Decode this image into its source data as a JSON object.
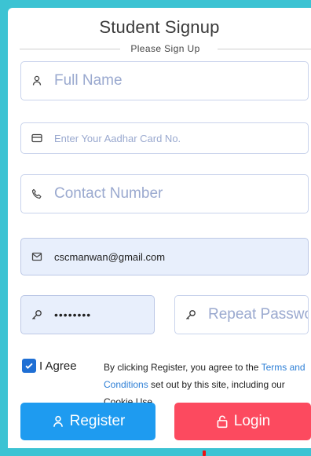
{
  "form": {
    "title": "Student Signup",
    "subtitle": "Please Sign Up",
    "full_name": {
      "placeholder": "Full Name",
      "value": "",
      "icon": "user-icon"
    },
    "aadhar": {
      "placeholder": "Enter Your Aadhar Card No.",
      "value": "",
      "icon": "id-card-icon"
    },
    "contact": {
      "placeholder": "Contact Number",
      "value": "",
      "icon": "phone-icon"
    },
    "email": {
      "placeholder": "",
      "value": "cscmanwan@gmail.com",
      "icon": "envelope-icon"
    },
    "password": {
      "placeholder": "",
      "value": "mypass12",
      "icon": "key-icon"
    },
    "repeat_password": {
      "placeholder": "Repeat Password",
      "value": "",
      "icon": "key-icon"
    },
    "agree": {
      "label": "I Agree",
      "checked": true
    },
    "terms": {
      "before": "By clicking Register, you agree to the ",
      "link": "Terms and Conditions",
      "after": " set out by this site, including our Cookie Use."
    },
    "register_label": "Register",
    "login_label": "Login"
  },
  "colors": {
    "background": "#3cc3d3",
    "register": "#1e9bf0",
    "login": "#fc4a5f",
    "checkbox": "#1f6fd4",
    "link": "#2d7fd6"
  }
}
